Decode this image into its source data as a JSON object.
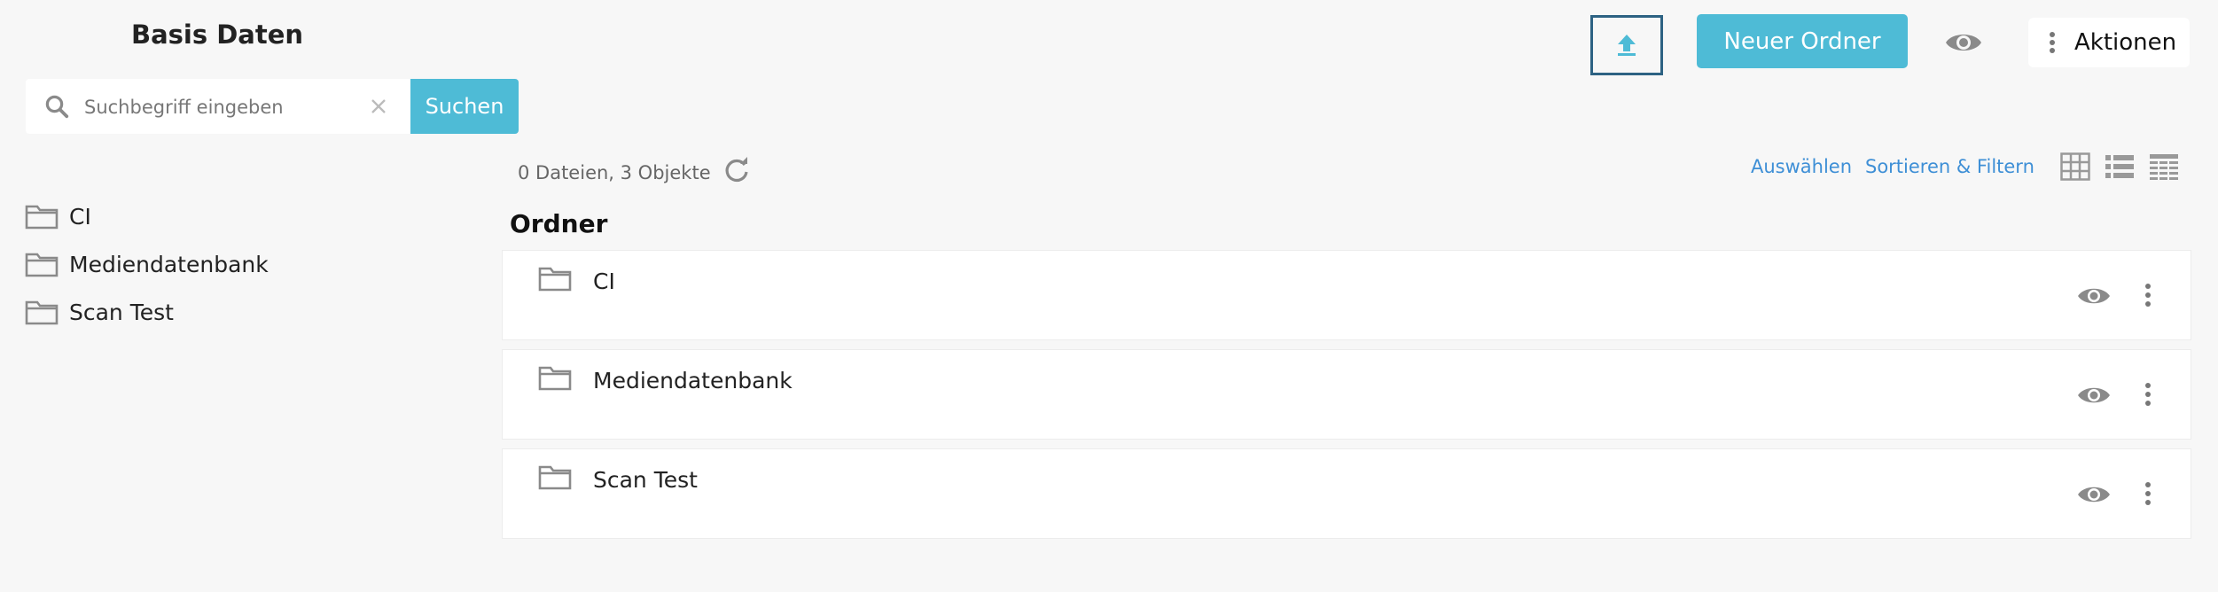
{
  "page": {
    "title": "Basis Daten"
  },
  "search": {
    "placeholder": "Suchbegriff eingeben",
    "value": "",
    "button_label": "Suchen"
  },
  "sidebar": {
    "folders": [
      {
        "label": "CI",
        "icon": "folder-icon"
      },
      {
        "label": "Mediendatenbank",
        "icon": "folder-icon"
      },
      {
        "label": "Scan Test",
        "icon": "folder-icon"
      }
    ]
  },
  "toolbar": {
    "upload_icon": "upload-icon",
    "new_folder_label": "Neuer Ordner",
    "visibility_icon": "eye-icon",
    "actions_label": "Aktionen"
  },
  "content": {
    "count_text": "0 Dateien, 3 Objekte",
    "select_label": "Auswählen",
    "sort_filter_label": "Sortieren & Filtern",
    "view_modes": [
      "grid-view-icon",
      "list-view-icon",
      "table-view-icon"
    ],
    "section_title": "Ordner",
    "folders": [
      {
        "label": "CI"
      },
      {
        "label": "Mediendatenbank"
      },
      {
        "label": "Scan Test"
      }
    ]
  },
  "colors": {
    "accent": "#4ebbd6",
    "link": "#3e8fd6",
    "upload_border": "#2d6283",
    "background": "#f7f7f7",
    "icon_gray": "#8a8a8a"
  }
}
